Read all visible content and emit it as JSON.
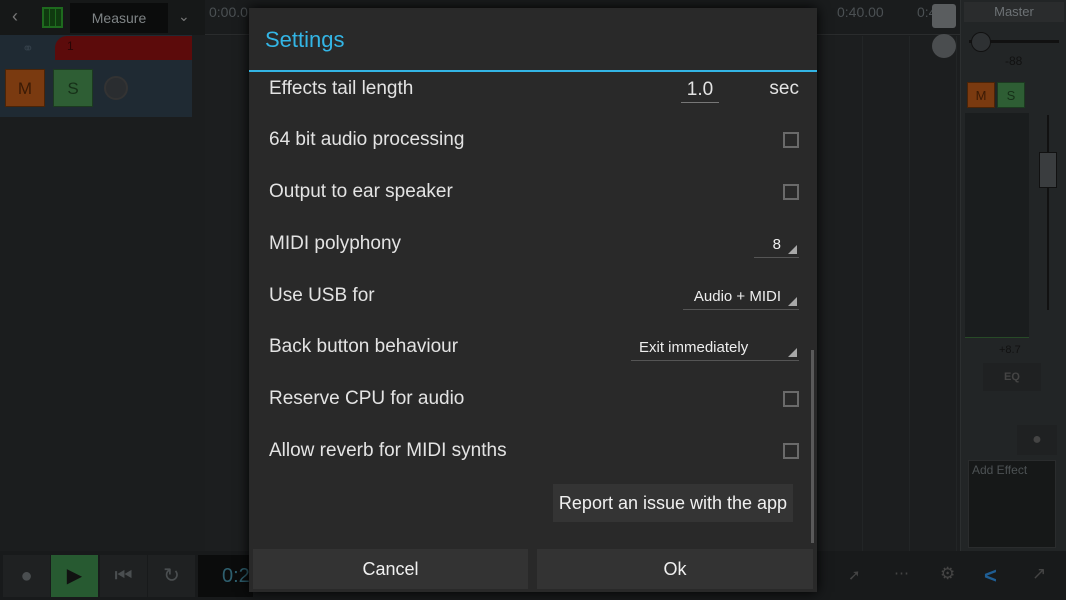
{
  "topbar": {
    "view_mode": "Measure"
  },
  "ruler": {
    "start_label": "0:00.0",
    "label_40": "0:40.00",
    "label_partial": "0:4"
  },
  "track": {
    "mute": "M",
    "solo": "S",
    "name": "1"
  },
  "master": {
    "title": "Master",
    "pan_value": "-88",
    "mute": "M",
    "solo": "S",
    "volume": "+8.7",
    "eq": "EQ",
    "add_effect": "Add Effect",
    "fader_level_db": 8.7
  },
  "transport": {
    "time_partial": "0:2"
  },
  "dialog": {
    "title": "Settings",
    "accent": "#33b5e5",
    "settings": [
      {
        "label": "Effects tail length",
        "type": "number",
        "value": "1.0",
        "unit": "sec"
      },
      {
        "label": "64 bit audio processing",
        "type": "checkbox",
        "checked": false
      },
      {
        "label": "Output to ear speaker",
        "type": "checkbox",
        "checked": false
      },
      {
        "label": "MIDI polyphony",
        "type": "select",
        "value": "8"
      },
      {
        "label": "Use USB for",
        "type": "select",
        "value": "Audio + MIDI"
      },
      {
        "label": "Back button behaviour",
        "type": "select",
        "value": "Exit immediately"
      },
      {
        "label": "Reserve CPU for audio",
        "type": "checkbox",
        "checked": false
      },
      {
        "label": "Allow reverb for MIDI synths",
        "type": "checkbox",
        "checked": false
      }
    ],
    "report_button": "Report an issue with the app",
    "cancel": "Cancel",
    "ok": "Ok"
  }
}
